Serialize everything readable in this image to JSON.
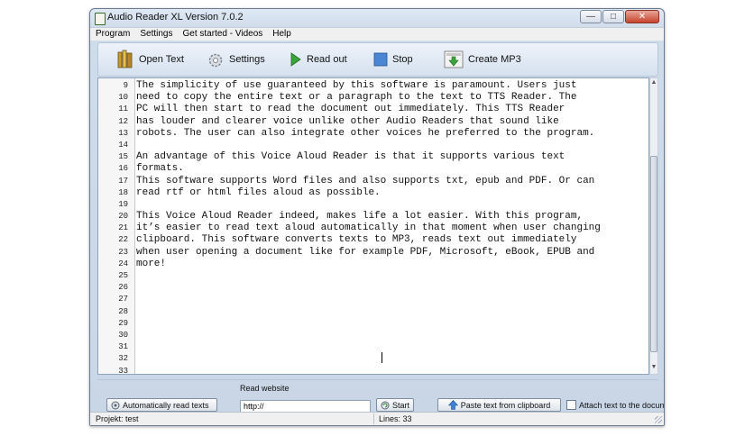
{
  "window": {
    "title": "Audio Reader XL Version 7.0.2"
  },
  "menu": [
    {
      "label": "Program"
    },
    {
      "label": "Settings"
    },
    {
      "label": "Get started - Videos"
    },
    {
      "label": "Help"
    }
  ],
  "toolbar": {
    "open_text": "Open Text",
    "settings": "Settings",
    "read_out": "Read out",
    "stop": "Stop",
    "create_mp3": "Create MP3"
  },
  "editor": {
    "lines": [
      {
        "n": "9",
        "text": "The simplicity of use guaranteed by this software is paramount. Users just"
      },
      {
        "n": "10",
        "text": "need to copy the entire text or a paragraph to the text to TTS Reader. The"
      },
      {
        "n": "11",
        "text": "PC will then start to read the document out immediately. This TTS Reader"
      },
      {
        "n": "12",
        "text": "has louder and clearer voice unlike other Audio Readers that sound like"
      },
      {
        "n": "13",
        "text": "robots. The user can also integrate other voices he preferred to the program."
      },
      {
        "n": "14",
        "text": ""
      },
      {
        "n": "15",
        "text": "An advantage of this Voice Aloud Reader is that it supports various text"
      },
      {
        "n": "16",
        "text": "formats."
      },
      {
        "n": "17",
        "text": "This software supports Word files and also supports txt, epub and PDF. Or can"
      },
      {
        "n": "18",
        "text": "read rtf or html files aloud as possible."
      },
      {
        "n": "19",
        "text": ""
      },
      {
        "n": "20",
        "text": "This Voice Aloud Reader indeed, makes life a lot easier. With this program,"
      },
      {
        "n": "21",
        "text": "it’s easier to read text aloud automatically in that moment when user changing"
      },
      {
        "n": "22",
        "text": "clipboard. This software converts texts to MP3, reads text out immediately"
      },
      {
        "n": "23",
        "text": "when user opening a document like for example PDF, Microsoft, eBook, EPUB and"
      },
      {
        "n": "24",
        "text": "more!"
      },
      {
        "n": "25",
        "text": ""
      },
      {
        "n": "26",
        "text": ""
      },
      {
        "n": "27",
        "text": ""
      },
      {
        "n": "28",
        "text": ""
      },
      {
        "n": "29",
        "text": ""
      },
      {
        "n": "30",
        "text": ""
      },
      {
        "n": "31",
        "text": ""
      },
      {
        "n": "32",
        "text": ""
      },
      {
        "n": "33",
        "text": ""
      }
    ]
  },
  "bottom": {
    "auto_read": "Automatically read texts",
    "read_website_label": "Read website",
    "url_value": "http://",
    "start": "Start",
    "paste": "Paste text from clipboard",
    "attach": "Attach text to the document"
  },
  "status": {
    "projekt": "Projekt: test",
    "lines": "Lines: 33"
  }
}
